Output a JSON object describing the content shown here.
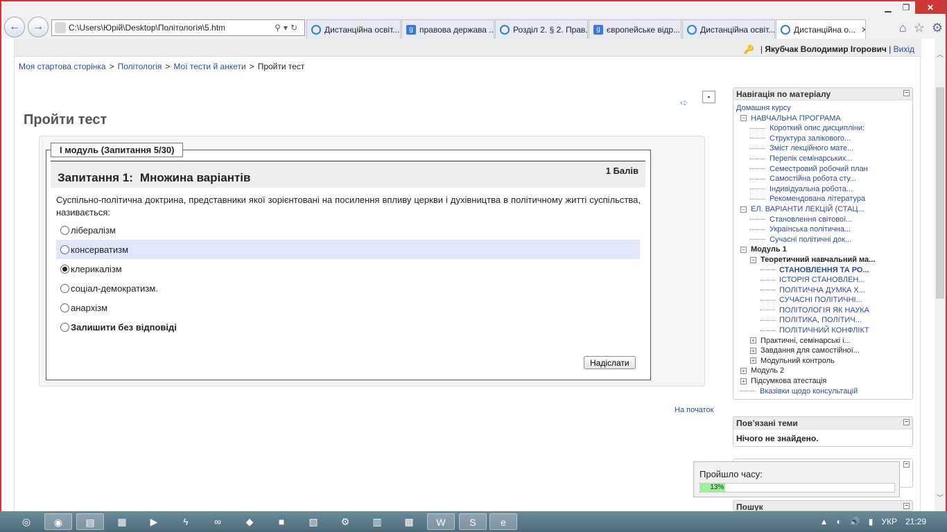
{
  "browser": {
    "address": "C:\\Users\\Юрій\\Desktop\\Політологія\\5.htm",
    "tabs": [
      {
        "label": "Дистанційна освіт...",
        "icon": "ie-icon",
        "active": false
      },
      {
        "label": "правова держава ...",
        "icon": "google-icon",
        "active": false
      },
      {
        "label": "Розділ 2. § 2. Прав...",
        "icon": "ie-icon",
        "active": false
      },
      {
        "label": "європейське відр...",
        "icon": "google-icon",
        "active": false
      },
      {
        "label": "Дистанційна освіт...",
        "icon": "ie-icon",
        "active": false
      },
      {
        "label": "Дистанційна о...",
        "icon": "ie-icon",
        "active": true
      }
    ],
    "tab_close": "✕"
  },
  "userbar": {
    "sep1": "|",
    "user_name": "Якубчак Володимир Ігорович",
    "sep2": "|",
    "logout": "Вихід"
  },
  "breadcrumb": {
    "items": [
      "Моя стартова сторінка",
      "Політологія",
      "Мої тести й анкети"
    ],
    "current": "Пройти тест",
    "separator": ">"
  },
  "page_title": "Пройти тест",
  "quiz": {
    "legend": "І модуль (Запитання 5/30)",
    "question_label": "Запитання 1:",
    "question_type": "Множина варіантів",
    "points": "1 Балів",
    "question_text": "Суспільно-політична доктрина, представники якої зорієнтовані на посилення впливу церкви і духівництва в політичному житті суспільства, називається:",
    "options": [
      {
        "label": "лібералізм",
        "selected": false
      },
      {
        "label": "консерватизм",
        "selected": false
      },
      {
        "label": "клерикалізм",
        "selected": true
      },
      {
        "label": "соціал-демократизм.",
        "selected": false
      },
      {
        "label": "анархізм",
        "selected": false
      },
      {
        "label": "Залишити без відповіді",
        "selected": false
      }
    ],
    "submit_label": "Надіслати"
  },
  "to_top": "На початок",
  "nav_block": {
    "title": "Навігація по матеріалу",
    "home": "Домашня курсу",
    "items": [
      {
        "label": "НАВЧАЛЬНА ПРОГРАМА",
        "level": 1,
        "toggle": "−",
        "style": "link"
      },
      {
        "label": "Короткий опис дисципліни:",
        "level": 2,
        "style": "link"
      },
      {
        "label": "Структура залікового...",
        "level": 2,
        "style": "link"
      },
      {
        "label": "Зміст лекційного мате...",
        "level": 2,
        "style": "link"
      },
      {
        "label": "Перелік семінарських...",
        "level": 2,
        "style": "link"
      },
      {
        "label": "Семестровий робочий план",
        "level": 2,
        "style": "link"
      },
      {
        "label": "Самостійна робота сту...",
        "level": 2,
        "style": "link"
      },
      {
        "label": "Індивідуальна робота...",
        "level": 2,
        "style": "link"
      },
      {
        "label": "Рекомендована література",
        "level": 2,
        "style": "link"
      },
      {
        "label": "ЕЛ. ВАРІАНТИ ЛЕКЦІЙ (СТАЦ...",
        "level": 1,
        "toggle": "−",
        "style": "link"
      },
      {
        "label": "Становлення світової...",
        "level": 2,
        "style": "link"
      },
      {
        "label": "Українська політична...",
        "level": 2,
        "style": "link"
      },
      {
        "label": "Сучасні політичні док...",
        "level": 2,
        "style": "link"
      },
      {
        "label": "Модуль 1",
        "level": 1,
        "toggle": "−",
        "style": "bold"
      },
      {
        "label": "Теоретичний навчальний ма...",
        "level": 2,
        "toggle": "−",
        "style": "bold"
      },
      {
        "label": "СТАНОВЛЕННЯ ТА РО...",
        "level": 3,
        "style": "current"
      },
      {
        "label": "ІСТОРІЯ СТАНОВЛЕН...",
        "level": 3,
        "style": "link"
      },
      {
        "label": "ПОЛІТИЧНА ДУМКА Х...",
        "level": 3,
        "style": "link"
      },
      {
        "label": "СУЧАСНІ ПОЛІТИЧНІ...",
        "level": 3,
        "style": "link"
      },
      {
        "label": "ПОЛІТОЛОГІЯ ЯК НАУКА",
        "level": 3,
        "style": "link"
      },
      {
        "label": "ПОЛІТИКА, ПОЛІТИЧ...",
        "level": 3,
        "style": "link"
      },
      {
        "label": "ПОЛІТИЧНИЙ КОНФЛІКТ",
        "level": 3,
        "style": "link"
      },
      {
        "label": "Практичні, семінарські і...",
        "level": 2,
        "toggle": "+",
        "style": "plain"
      },
      {
        "label": "Завдання для самостійної...",
        "level": 2,
        "toggle": "+",
        "style": "plain"
      },
      {
        "label": "Модульний контроль",
        "level": 2,
        "toggle": "+",
        "style": "plain"
      },
      {
        "label": "Модуль 2",
        "level": 1,
        "toggle": "+",
        "style": "plain"
      },
      {
        "label": "Підсумкова атестація",
        "level": 1,
        "toggle": "+",
        "style": "plain"
      },
      {
        "label": "Вказівки щодо консультацій",
        "level": 1,
        "style": "link"
      }
    ]
  },
  "related_block": {
    "title": "Пов’язані теми",
    "empty": "Нічого не знайдено."
  },
  "timer": {
    "label": "Пройшло часу:",
    "percent_text": "13%",
    "progress": 0.13
  },
  "search_block": {
    "title": "Пошук"
  },
  "taskbar": {
    "lang": "УКР",
    "time": "21:29"
  },
  "colors": {
    "link": "#2a4d8f",
    "highlight": "#e1e6fb",
    "progress": "#9cf09c",
    "frame": "#d6323a"
  }
}
